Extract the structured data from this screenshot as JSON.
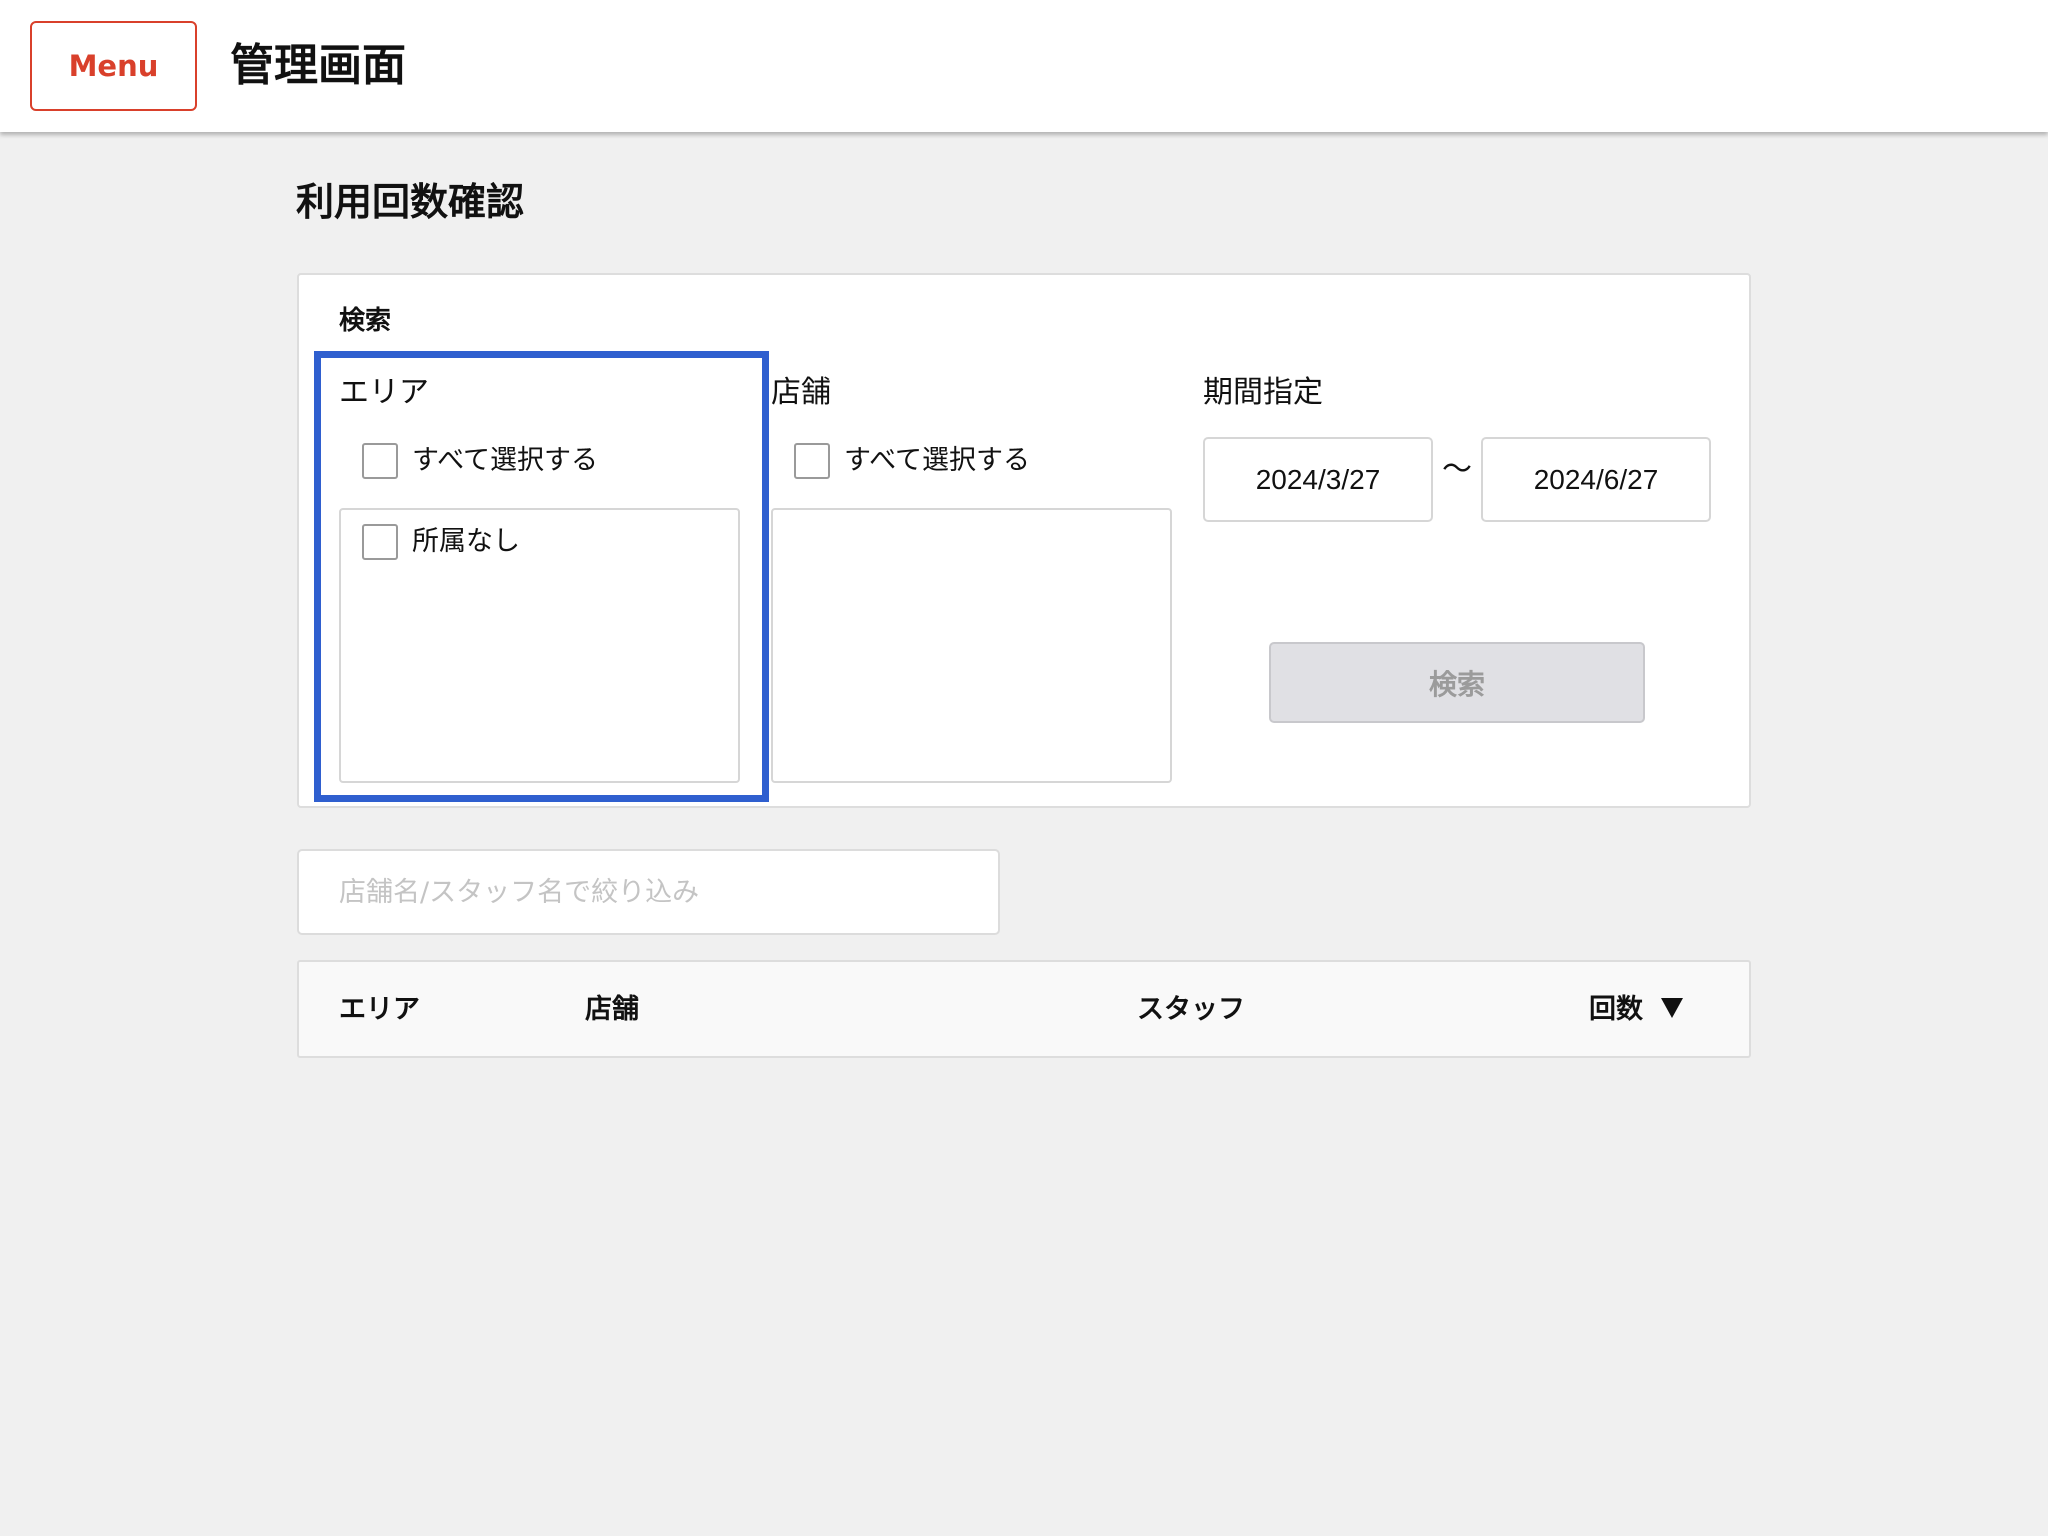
{
  "header": {
    "menu_label": "Menu",
    "app_title": "管理画面"
  },
  "page": {
    "title": "利用回数確認"
  },
  "search": {
    "label": "検索",
    "area": {
      "title": "エリア",
      "select_all": "すべて選択する",
      "items": [
        {
          "label": "所属なし",
          "checked": false
        }
      ]
    },
    "store": {
      "title": "店舗",
      "select_all": "すべて選択する",
      "items": []
    },
    "period": {
      "title": "期間指定",
      "from": "2024/3/27",
      "separator": "～",
      "to": "2024/6/27"
    },
    "button_label": "検索"
  },
  "filter": {
    "placeholder": "店舗名/スタッフ名で絞り込み",
    "value": ""
  },
  "table": {
    "columns": [
      "エリア",
      "店舗",
      "スタッフ",
      "回数"
    ],
    "sort_icon": "sort-desc-triangle-icon",
    "rows": []
  },
  "colors": {
    "accent": "#d9402b",
    "highlight": "#2f5fcf",
    "button_disabled_bg": "#e0e0e4"
  }
}
